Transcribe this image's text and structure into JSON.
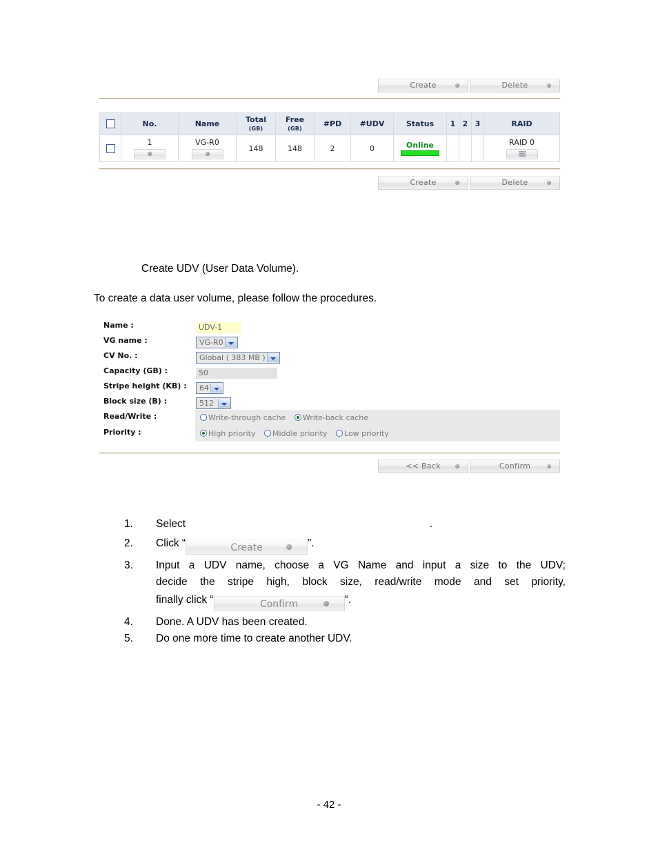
{
  "document": {
    "page_number": "- 42 -"
  },
  "vg_panel": {
    "top_buttons": [
      {
        "label": "Create",
        "icon": "dot-icon"
      },
      {
        "label": "Delete",
        "icon": "dot-icon"
      }
    ],
    "bottom_buttons": [
      {
        "label": "Create",
        "icon": "dot-icon"
      },
      {
        "label": "Delete",
        "icon": "dot-icon"
      }
    ],
    "table": {
      "headers": [
        {
          "label": "",
          "sub": ""
        },
        {
          "label": "No.",
          "sub": ""
        },
        {
          "label": "Name",
          "sub": ""
        },
        {
          "label": "Total",
          "sub": "(GB)"
        },
        {
          "label": "Free",
          "sub": "(GB)"
        },
        {
          "label": "#PD",
          "sub": ""
        },
        {
          "label": "#UDV",
          "sub": ""
        },
        {
          "label": "Status",
          "sub": ""
        },
        {
          "label": "1",
          "sub": ""
        },
        {
          "label": "2",
          "sub": ""
        },
        {
          "label": "3",
          "sub": ""
        },
        {
          "label": "RAID",
          "sub": ""
        }
      ],
      "rows": [
        {
          "no": "1",
          "name": "VG-R0",
          "total_gb": "148",
          "free_gb": "148",
          "pd": "2",
          "udv": "0",
          "status": "Online",
          "slot1": "",
          "slot2": "",
          "slot3": "",
          "raid": "RAID 0"
        }
      ]
    }
  },
  "section": {
    "heading": "Create UDV (User Data Volume).",
    "intro": "To create a data user volume, please follow the procedures."
  },
  "udv_form": {
    "fields": [
      {
        "label": "Name :",
        "type": "text",
        "value": "UDV-1"
      },
      {
        "label": "VG name :",
        "type": "select",
        "value": "VG-R0"
      },
      {
        "label": "CV No. :",
        "type": "select",
        "value": "Global ( 383 MB )"
      },
      {
        "label": "Capacity (GB) :",
        "type": "text",
        "value": "50"
      },
      {
        "label": "Stripe height (KB) :",
        "type": "select",
        "value": "64"
      },
      {
        "label": "Block size (B) :",
        "type": "select",
        "value": "512"
      }
    ],
    "read_write": {
      "label": "Read/Write :",
      "options": [
        {
          "label": "Write-through cache",
          "selected": false
        },
        {
          "label": "Write-back cache",
          "selected": true
        }
      ]
    },
    "priority": {
      "label": "Priority :",
      "options": [
        {
          "label": "High priority",
          "selected": true
        },
        {
          "label": "Middle priority",
          "selected": false
        },
        {
          "label": "Low priority",
          "selected": false
        }
      ]
    },
    "footer_buttons": [
      {
        "label": "<< Back",
        "icon": "dot-icon"
      },
      {
        "label": "Confirm",
        "icon": "dot-icon"
      }
    ]
  },
  "procedures": [
    {
      "num": "1.",
      "text_before": "Select",
      "text_after": ".",
      "button": null
    },
    {
      "num": "2.",
      "text_before": "Click “",
      "text_after": "”.",
      "button": "Create"
    },
    {
      "num": "3.",
      "line1": "Input a UDV name, choose a VG Name and input a size to the UDV;",
      "line2": "decide the stripe high, block size, read/write mode and set priority,",
      "line3_before": "finally click “",
      "line3_after": "“.",
      "button": "Confirm"
    },
    {
      "num": "4.",
      "text_before": "Done. A UDV has been created.",
      "text_after": "",
      "button": null
    },
    {
      "num": "5.",
      "text_before": "Do one more time to create another UDV.",
      "text_after": "",
      "button": null
    }
  ]
}
